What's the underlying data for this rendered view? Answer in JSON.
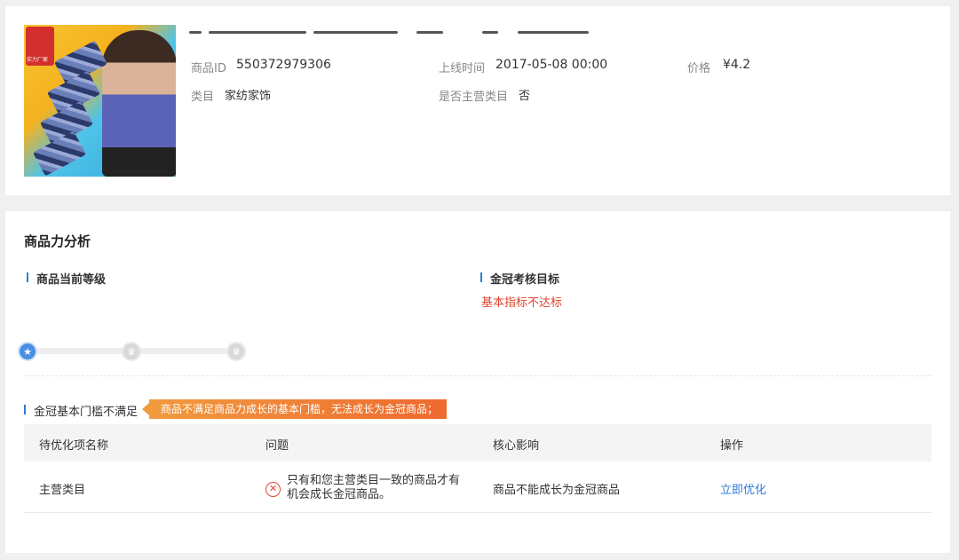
{
  "product": {
    "image_alt": "product-photo",
    "badge_text": "实力厂家",
    "id_label": "商品ID",
    "id_value": "550372979306",
    "launch_label": "上线时间",
    "launch_value": "2017-05-08 00:00",
    "price_label": "价格",
    "price_value": "¥4.2",
    "category_label": "类目",
    "category_value": "家纺家饰",
    "main_category_label": "是否主营类目",
    "main_category_value": "否"
  },
  "analysis": {
    "title": "商品力分析",
    "current_level_heading": "商品当前等级",
    "target_heading": "金冠考核目标",
    "target_warning": "基本指标不达标",
    "levels": [
      {
        "icon": "star-icon",
        "glyph": "★",
        "active": true
      },
      {
        "icon": "crown-icon",
        "glyph": "♛",
        "active": false
      },
      {
        "icon": "gold-crown-icon",
        "glyph": "♛",
        "active": false
      }
    ],
    "threshold_heading": "金冠基本门槛不满足",
    "threshold_tag": "商品不满足商品力成长的基本门槛，无法成长为金冠商品；",
    "table": {
      "headers": [
        "待优化项名称",
        "问题",
        "核心影响",
        "操作"
      ],
      "rows": [
        {
          "name": "主营类目",
          "problem": "只有和您主营类目一致的商品才有机会成长金冠商品。",
          "impact": "商品不能成长为金冠商品",
          "action": "立即优化"
        }
      ]
    }
  },
  "colors": {
    "accent_blue": "#2f7bd8",
    "warning_red": "#e0452f",
    "tag_orange": "#ee6a2f"
  }
}
